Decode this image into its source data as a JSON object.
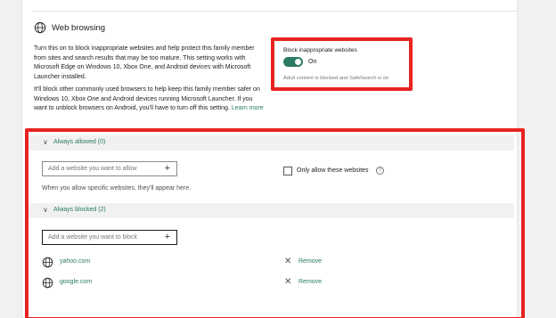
{
  "section": {
    "title": "Web browsing",
    "description_1": "Turn this on to block inappropriate websites and help protect this family member from sites and search results that may be too mature. This setting works with Microsoft Edge on Windows 10, Xbox One, and Android devices with Microsoft Launcher installed.",
    "description_2": "It'll block other commonly used browsers to help keep this family member safer on Windows 10, Xbox One and Android devices running Microsoft Launcher. If you want to unblock browsers on Android, you'll have to turn off this setting.",
    "learn_more": "Learn more"
  },
  "block_setting": {
    "label": "Block inappropriate websites",
    "toggle_state": "On",
    "note": "Adult content is blocked and SafeSearch is on"
  },
  "allowed": {
    "header": "Always allowed (0)",
    "input_placeholder": "Add a website you want to allow",
    "only_allow_label": "Only allow these websites",
    "hint": "When you allow specific websites, they'll appear here."
  },
  "blocked": {
    "header": "Always blocked (2)",
    "input_placeholder": "Add a website you want to block",
    "sites": [
      {
        "name": "yahoo.com",
        "action": "Remove"
      },
      {
        "name": "google.com",
        "action": "Remove"
      }
    ]
  },
  "icons": {
    "add": "+",
    "remove": "✕",
    "chevron": "∨",
    "info": "?"
  },
  "colors": {
    "accent": "#2b7a63",
    "highlight": "#e8231f"
  }
}
